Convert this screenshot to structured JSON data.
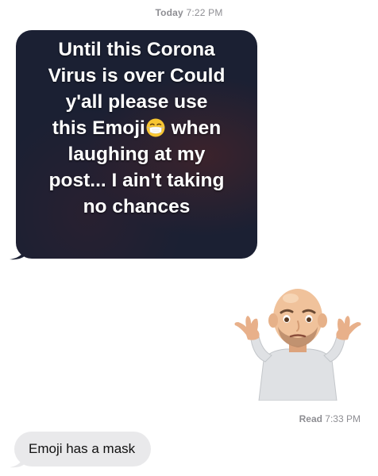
{
  "conversation": {
    "timestamp_day": "Today",
    "timestamp_time": "7:22 PM",
    "messages": [
      {
        "type": "image",
        "direction": "incoming",
        "lines": [
          "Until this Corona",
          "Virus is over Could",
          "y'all please use",
          "this Emoji",
          "when",
          "laughing at my",
          "post... I ain't taking",
          "no chances"
        ],
        "emoji_icon": "mask-face-emoji"
      },
      {
        "type": "sticker",
        "direction": "outgoing",
        "icon": "shrugging-memoji"
      },
      {
        "type": "text",
        "direction": "incoming",
        "text": "Emoji has a mask"
      }
    ],
    "read_label": "Read",
    "read_time": "7:33 PM"
  },
  "colors": {
    "incoming_bubble": "#e9e9eb",
    "meme_background": "#1b2033",
    "meta_text": "#8e8e93"
  }
}
